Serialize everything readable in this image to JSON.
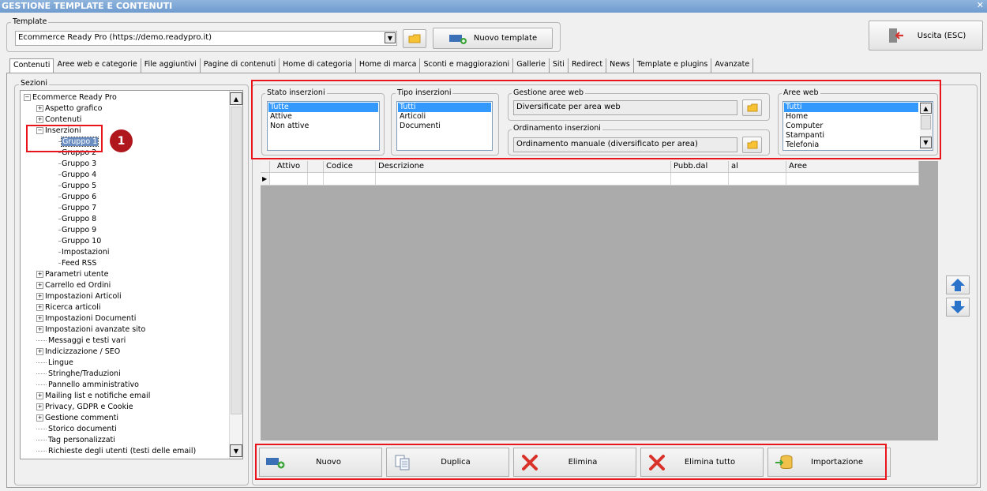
{
  "window": {
    "title": "GESTIONE TEMPLATE E CONTENUTI",
    "close": "✕"
  },
  "template": {
    "label": "Template",
    "value": "Ecommerce Ready Pro (https://demo.readypro.it)",
    "new_button": "Nuovo template"
  },
  "exit_button": "Uscita (ESC)",
  "tabs": [
    "Contenuti",
    "Aree web e categorie",
    "File aggiuntivi",
    "Pagine di contenuti",
    "Home di categoria",
    "Home di marca",
    "Sconti e maggiorazioni",
    "Gallerie",
    "Siti",
    "Redirect",
    "News",
    "Template e plugins",
    "Avanzate"
  ],
  "sections": {
    "label": "Sezioni",
    "root": "Ecommerce Ready Pro",
    "items": [
      {
        "label": "Aspetto grafico",
        "level": 1,
        "exp": "+"
      },
      {
        "label": "Contenuti",
        "level": 1,
        "exp": "+"
      },
      {
        "label": "Inserzioni",
        "level": 1,
        "exp": "-"
      },
      {
        "label": "Gruppo 1",
        "level": 2,
        "exp": "",
        "selected": true
      },
      {
        "label": "Gruppo 2",
        "level": 2,
        "exp": ""
      },
      {
        "label": "Gruppo 3",
        "level": 2,
        "exp": ""
      },
      {
        "label": "Gruppo 4",
        "level": 2,
        "exp": ""
      },
      {
        "label": "Gruppo 5",
        "level": 2,
        "exp": ""
      },
      {
        "label": "Gruppo 6",
        "level": 2,
        "exp": ""
      },
      {
        "label": "Gruppo 7",
        "level": 2,
        "exp": ""
      },
      {
        "label": "Gruppo 8",
        "level": 2,
        "exp": ""
      },
      {
        "label": "Gruppo 9",
        "level": 2,
        "exp": ""
      },
      {
        "label": "Gruppo 10",
        "level": 2,
        "exp": ""
      },
      {
        "label": "Impostazioni",
        "level": 2,
        "exp": ""
      },
      {
        "label": "Feed RSS",
        "level": 2,
        "exp": ""
      },
      {
        "label": "Parametri utente",
        "level": 1,
        "exp": "+"
      },
      {
        "label": "Carrello ed Ordini",
        "level": 1,
        "exp": "+"
      },
      {
        "label": "Impostazioni Articoli",
        "level": 1,
        "exp": "+"
      },
      {
        "label": "Ricerca articoli",
        "level": 1,
        "exp": "+"
      },
      {
        "label": "Impostazioni Documenti",
        "level": 1,
        "exp": "+"
      },
      {
        "label": "Impostazioni avanzate sito",
        "level": 1,
        "exp": "+"
      },
      {
        "label": "Messaggi e testi vari",
        "level": 1,
        "exp": ""
      },
      {
        "label": "Indicizzazione / SEO",
        "level": 1,
        "exp": "+"
      },
      {
        "label": "Lingue",
        "level": 1,
        "exp": ""
      },
      {
        "label": "Stringhe/Traduzioni",
        "level": 1,
        "exp": ""
      },
      {
        "label": "Pannello amministrativo",
        "level": 1,
        "exp": ""
      },
      {
        "label": "Mailing list e notifiche email",
        "level": 1,
        "exp": "+"
      },
      {
        "label": "Privacy, GDPR e Cookie",
        "level": 1,
        "exp": "+"
      },
      {
        "label": "Gestione commenti",
        "level": 1,
        "exp": "+"
      },
      {
        "label": "Storico documenti",
        "level": 1,
        "exp": ""
      },
      {
        "label": "Tag personalizzati",
        "level": 1,
        "exp": ""
      },
      {
        "label": "Richieste degli utenti (testi delle email)",
        "level": 1,
        "exp": ""
      }
    ]
  },
  "badge": "1",
  "filters": {
    "stato": {
      "label": "Stato inserzioni",
      "options": [
        "Tutte",
        "Attive",
        "Non attive"
      ],
      "selected": "Tutte"
    },
    "tipo": {
      "label": "Tipo inserzioni",
      "options": [
        "Tutti",
        "Articoli",
        "Documenti"
      ],
      "selected": "Tutti"
    },
    "gestione": {
      "label": "Gestione aree web",
      "value": "Diversificate per area web"
    },
    "ordinamento": {
      "label": "Ordinamento inserzioni",
      "value": "Ordinamento manuale (diversificato per area)"
    },
    "aree": {
      "label": "Aree web",
      "options": [
        "Tutti",
        "Home",
        "Computer",
        "Stampanti",
        "Telefonia"
      ],
      "selected": "Tutti"
    }
  },
  "grid": {
    "columns": [
      "Attivo",
      "",
      "Codice",
      "Descrizione",
      "Pubb.dal",
      "al",
      "Aree"
    ]
  },
  "actions": [
    "Nuovo",
    "Duplica",
    "Elimina",
    "Elimina tutto",
    "Importazione"
  ],
  "colors": {
    "red": "#e8161c",
    "blue_arrow": "#2a73c9",
    "selection": "#3399ff"
  }
}
